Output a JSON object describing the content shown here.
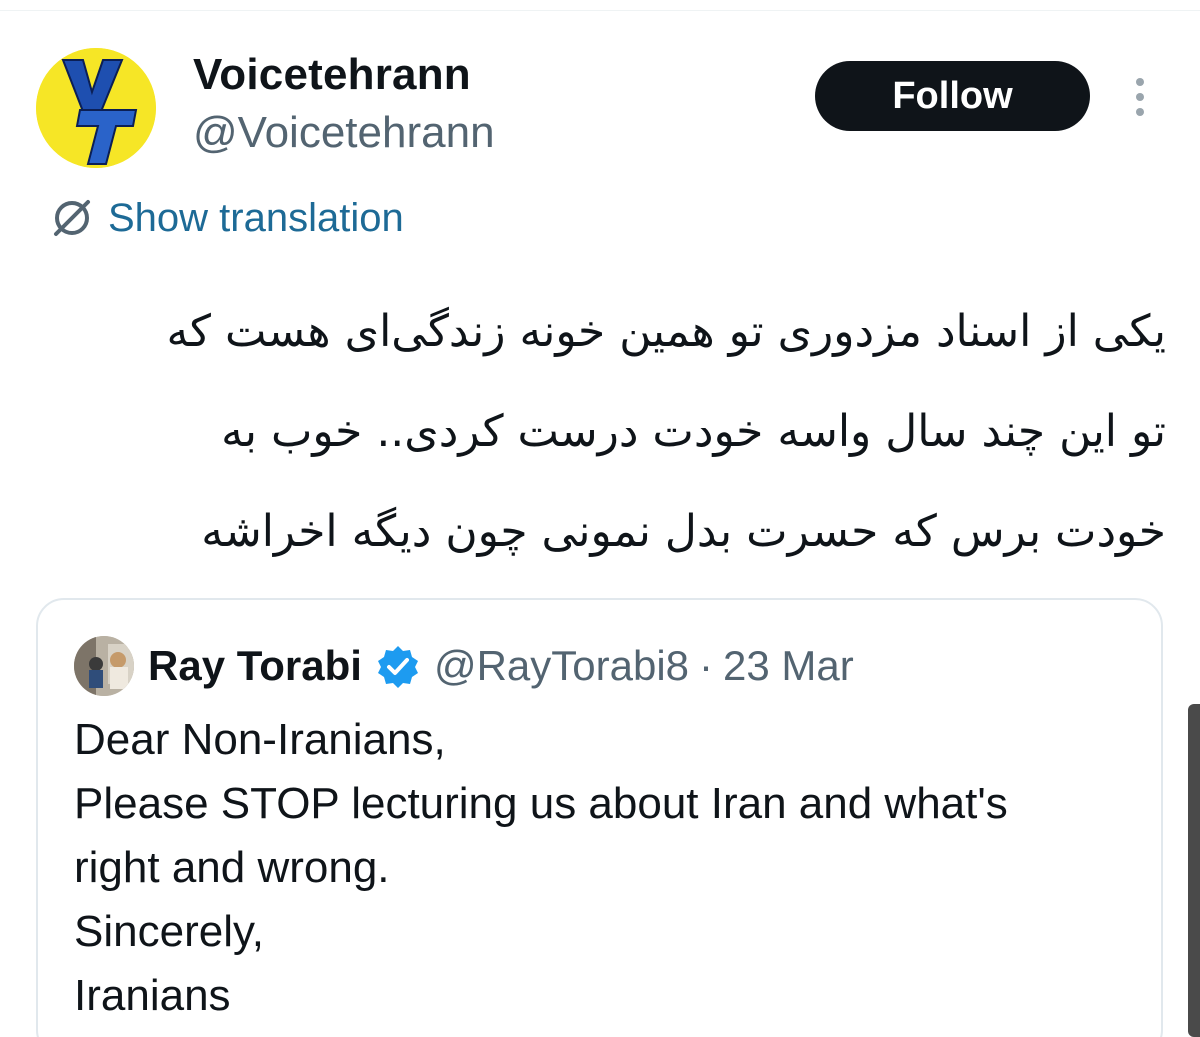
{
  "account": {
    "name": "Voicetehrann",
    "handle": "@Voicetehrann",
    "avatar_logo": "VT",
    "avatar_color": "#f6e626",
    "logo_color": "#1e4fb0"
  },
  "actions": {
    "follow_label": "Follow",
    "more_icon": "vertical-ellipsis-icon"
  },
  "translation": {
    "icon": "globe-icon",
    "label": "Show translation",
    "color": "#1d6a96"
  },
  "tweet": {
    "lines": [
      "یکی از اسناد مزدوری تو همین خونه زندگی‌ای هست که",
      "تو این چند سال واسه خودت درست کردی.. خوب به",
      "خودت برس که حسرت بدل نمونی چون دیگه اخراشه"
    ]
  },
  "quote": {
    "name": "Ray Torabi",
    "verified_icon": "verified-badge-icon",
    "verified_color": "#1d9bf0",
    "handle": "@RayTorabi8",
    "separator": "·",
    "date": "23 Mar",
    "body_lines": [
      "Dear Non-Iranians,",
      "Please STOP lecturing us about Iran and what's",
      "right and wrong.",
      "Sincerely,",
      "Iranians"
    ]
  },
  "colors": {
    "text": "#0f1419",
    "secondary": "#536471",
    "button_bg": "#0f1419",
    "border": "#e1e8ed"
  }
}
